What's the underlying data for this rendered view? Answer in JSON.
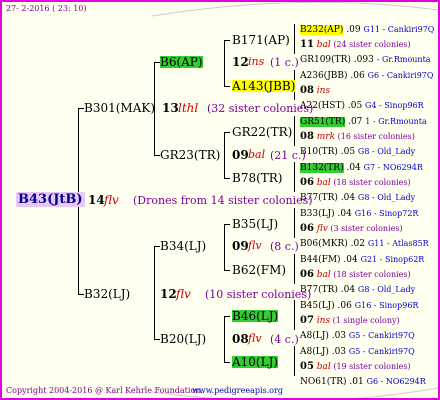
{
  "date": "27-  2-2016  ( 23: 10)",
  "footer": {
    "copyright": "Copyright 2004-2016 @ Karl Kehrle Foundation.",
    "url": "www.pedigreeapis.org"
  },
  "colors": {
    "border": "#e000e0",
    "green": "#33cc33",
    "yellow": "#ffff00",
    "purple": "#7a0099",
    "blue": "#0000cc",
    "red": "#cc0000"
  },
  "root": {
    "name": "B43(JtB)",
    "yr": "14",
    "ins": "flv",
    "note": "(Drones from 14 sister colonies)"
  },
  "p1": {
    "name": "B301(MAK)",
    "yr": "13",
    "ins": "lthl",
    "note": "(32 sister colonies)"
  },
  "p2": {
    "name": "B32(LJ)",
    "yr": "12",
    "ins": "flv",
    "note": "(10 sister colonies)"
  },
  "g1": {
    "name": "B6(AP)"
  },
  "g2": {
    "name": "GR23(TR)"
  },
  "g3": {
    "name": "B34(LJ)"
  },
  "g4": {
    "name": "B20(LJ)"
  },
  "gg1": {
    "name": "B171(AP)",
    "yr": "12",
    "ins": "ins",
    "note": "(1 c.)"
  },
  "gg2": {
    "name": "A143(JBB)",
    "yr": "",
    "ins": "",
    "note": ""
  },
  "gg3": {
    "name": "GR22(TR)",
    "yr": "09",
    "ins": "bal",
    "note": "(21 c.)"
  },
  "gg4": {
    "name": "B78(TR)",
    "yr": "",
    "ins": "",
    "note": ""
  },
  "gg5": {
    "name": "B35(LJ)",
    "yr": "09",
    "ins": "flv",
    "note": "(8 c.)"
  },
  "gg6": {
    "name": "B62(FM)",
    "yr": "",
    "ins": "",
    "note": ""
  },
  "gg7": {
    "name": "B46(LJ)",
    "yr": "08",
    "ins": "flv",
    "note": "(4 c.)"
  },
  "gg8": {
    "name": "A10(LJ)",
    "yr": "",
    "ins": "",
    "note": ""
  },
  "right": [
    {
      "a": "B232(AP)",
      "b": ".09",
      "c": "G11 - Cankiri97Q"
    },
    {
      "a": "11",
      "ins": "bal",
      "note": "(24 sister colonies)"
    },
    {
      "a": "GR109(TR)",
      "b": ".093",
      "c": "- Gr.Rmounta"
    },
    {
      "a": "A236(JBB)",
      "b": ".06",
      "c": "G6 - Cankiri97Q"
    },
    {
      "a": "08",
      "ins": "ins",
      "note": ""
    },
    {
      "a": "A22(HST)",
      "b": ".05",
      "c": "G4 - Sinop96R"
    },
    {
      "a": "GR51(TR)",
      "b": ".07",
      "c": "1 - Gr.Rmounta"
    },
    {
      "a": "08",
      "ins": "mrk",
      "note": "(16 sister colonies)"
    },
    {
      "a": "B10(TR)",
      "b": ".05",
      "c": "G8 - Old_Lady"
    },
    {
      "a": "B132(TR)",
      "b": ".04",
      "c": "G7 - NO6294R"
    },
    {
      "a": "06",
      "ins": "bal",
      "note": "(18 sister colonies)"
    },
    {
      "a": "B77(TR)",
      "b": ".04",
      "c": "G8 - Old_Lady"
    },
    {
      "a": "B33(LJ)",
      "b": ".04",
      "c": "G16 - Sinop72R"
    },
    {
      "a": "06",
      "ins": "flv",
      "note": "(3 sister colonies)"
    },
    {
      "a": "B06(MKR)",
      "b": ".02",
      "c": "G11 - Atlas85R"
    },
    {
      "a": "B44(FM)",
      "b": ".04",
      "c": "G21 - Sinop62R"
    },
    {
      "a": "06",
      "ins": "bal",
      "note": "(18 sister colonies)"
    },
    {
      "a": "B77(TR)",
      "b": ".04",
      "c": "G8 - Old_Lady"
    },
    {
      "a": "B45(LJ)",
      "b": ".06",
      "c": "G16 - Sinop96R"
    },
    {
      "a": "07",
      "ins": "ins",
      "note": "(1 single colony)"
    },
    {
      "a": "A8(LJ)",
      "b": ".03",
      "c": "G5 - Cankiri97Q"
    },
    {
      "a": "A8(LJ)",
      "b": ".03",
      "c": "G5 - Cankiri97Q"
    },
    {
      "a": "05",
      "ins": "bal",
      "note": "(19 sister colonies)"
    },
    {
      "a": "NO61(TR)",
      "b": ".01",
      "c": "G6 - NO6294R"
    }
  ]
}
